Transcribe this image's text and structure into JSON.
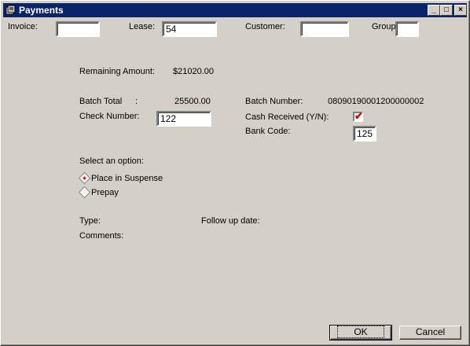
{
  "window": {
    "title": "Payments",
    "minimize": "_",
    "maximize": "□",
    "close": "×"
  },
  "filters": {
    "invoice_label": "Invoice:",
    "invoice_value": "",
    "lease_label": "Lease:",
    "lease_value": "54",
    "customer_label": "Customer:",
    "customer_value": "",
    "group_label": "Group",
    "group_value": ""
  },
  "summary": {
    "remaining_label": "Remaining Amount:",
    "remaining_value": "$21020.00",
    "batch_total_label": "Batch Total",
    "batch_total_colon": ":",
    "batch_total_value": "25500.00",
    "batch_number_label": "Batch Number:",
    "batch_number_value": "08090190001200000002",
    "check_number_label": "Check Number:",
    "check_number_value": "122",
    "cash_received_label": "Cash Received (Y/N):",
    "cash_received_mark": "✔",
    "bank_code_label": "Bank Code:",
    "bank_code_value": "125"
  },
  "options": {
    "prompt": "Select an option:",
    "items": [
      {
        "label": "Place in Suspense",
        "selected": true
      },
      {
        "label": "Prepay",
        "selected": false
      }
    ]
  },
  "details": {
    "type_label": "Type:",
    "follow_up_label": "Follow up date:",
    "comments_label": "Comments:"
  },
  "buttons": {
    "ok": "OK",
    "cancel": "Cancel"
  }
}
